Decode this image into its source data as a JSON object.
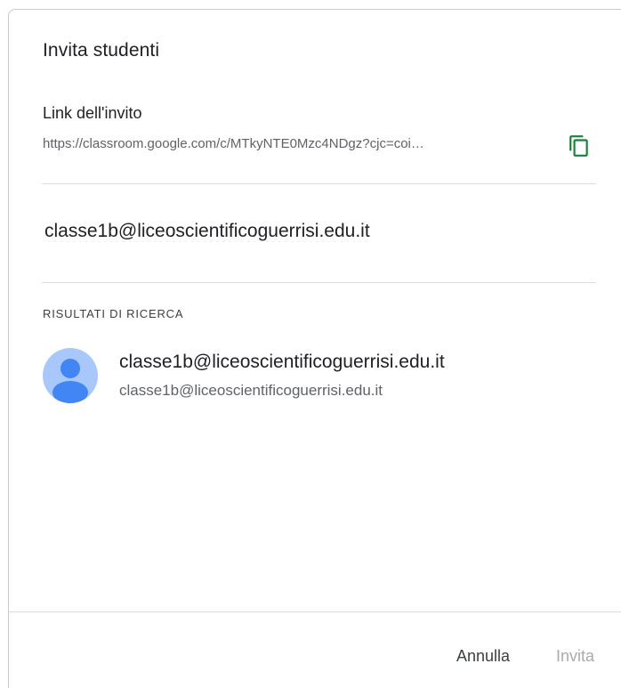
{
  "dialog": {
    "title": "Invita studenti"
  },
  "invite_link": {
    "label": "Link dell'invito",
    "url": "https://classroom.google.com/c/MTkyNTE0Mzc4NDgz?cjc=coi…"
  },
  "email_input": {
    "value": "classe1b@liceoscientificoguerrisi.edu.it"
  },
  "search_results": {
    "header": "RISULTATI DI RICERCA",
    "items": [
      {
        "name": "classe1b@liceoscientificoguerrisi.edu.it",
        "email": "classe1b@liceoscientificoguerrisi.edu.it"
      }
    ]
  },
  "actions": {
    "cancel_label": "Annulla",
    "invite_label": "Invita"
  },
  "colors": {
    "copy_icon": "#188038",
    "avatar_bg": "#a8c7fa",
    "avatar_fg": "#4285f4",
    "disabled_text": "#a8abae"
  },
  "icons": {
    "copy": "copy-icon",
    "avatar": "person-icon"
  }
}
